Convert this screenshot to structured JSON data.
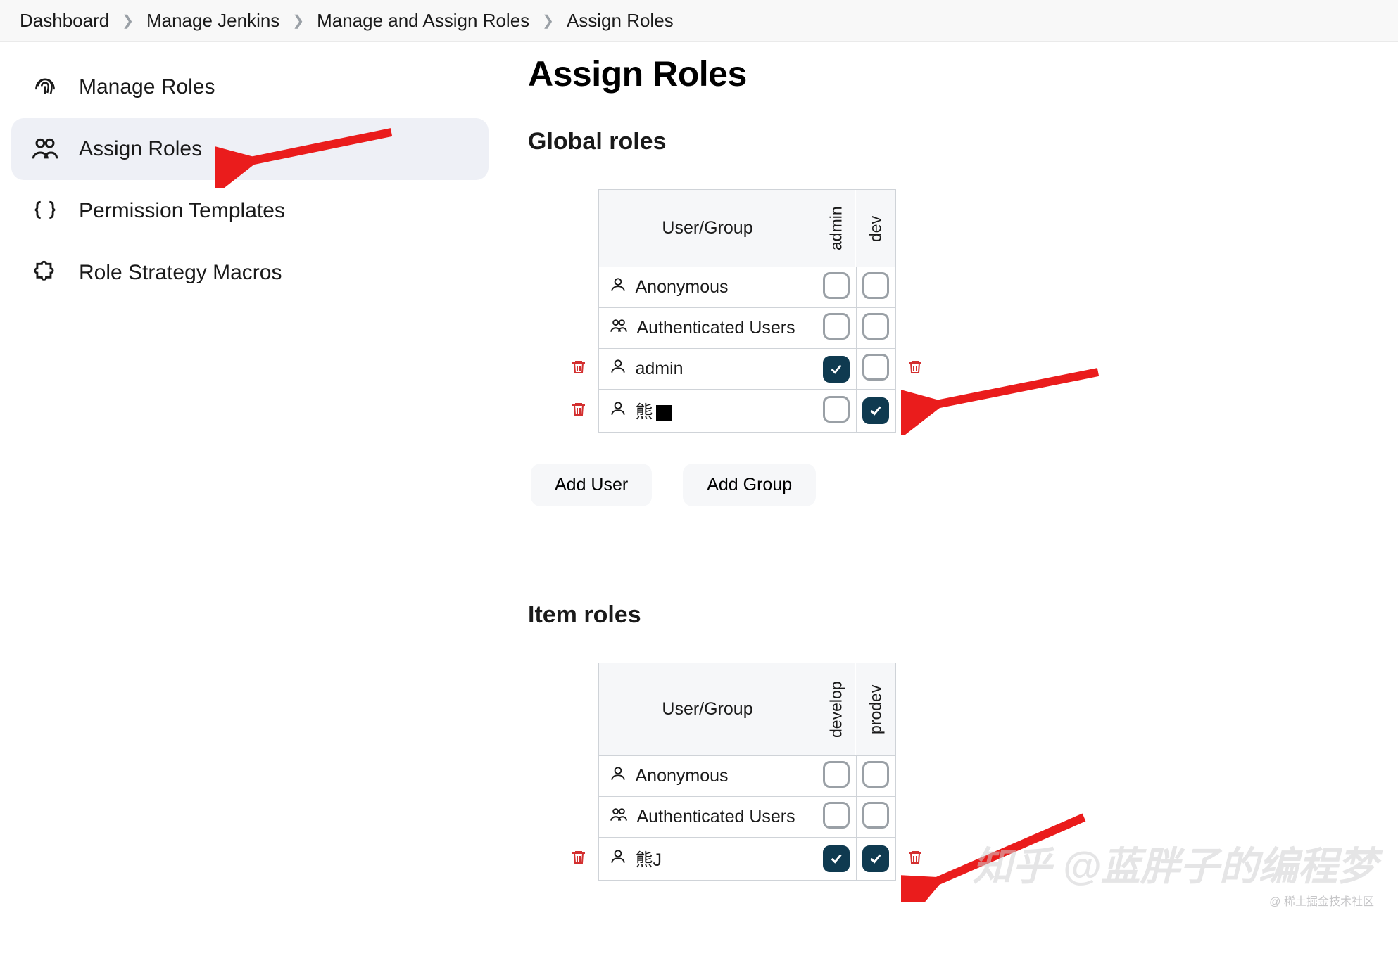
{
  "breadcrumb": [
    {
      "label": "Dashboard"
    },
    {
      "label": "Manage Jenkins"
    },
    {
      "label": "Manage and Assign Roles"
    },
    {
      "label": "Assign Roles"
    }
  ],
  "sidebar": {
    "items": [
      {
        "label": "Manage Roles"
      },
      {
        "label": "Assign Roles"
      },
      {
        "label": "Permission Templates"
      },
      {
        "label": "Role Strategy Macros"
      }
    ]
  },
  "page": {
    "title": "Assign Roles"
  },
  "global": {
    "section_title": "Global roles",
    "usergroup_header": "User/Group",
    "roles": [
      "admin",
      "dev"
    ],
    "rows": [
      {
        "name": "Anonymous",
        "icon": "user",
        "checks": [
          false,
          false
        ],
        "trash": false
      },
      {
        "name": "Authenticated Users",
        "icon": "group",
        "checks": [
          false,
          false
        ],
        "trash": false
      },
      {
        "name": "admin",
        "icon": "user",
        "checks": [
          true,
          false
        ],
        "trash": true
      },
      {
        "name": "熊",
        "icon": "user",
        "checks": [
          false,
          true
        ],
        "trash": true,
        "redacted": true
      }
    ],
    "add_user_label": "Add User",
    "add_group_label": "Add Group"
  },
  "item": {
    "section_title": "Item roles",
    "usergroup_header": "User/Group",
    "roles": [
      "develop",
      "prodev"
    ],
    "rows": [
      {
        "name": "Anonymous",
        "icon": "user",
        "checks": [
          false,
          false
        ],
        "trash": false
      },
      {
        "name": "Authenticated Users",
        "icon": "group",
        "checks": [
          false,
          false
        ],
        "trash": false
      },
      {
        "name": "熊J",
        "icon": "user",
        "checks": [
          true,
          true
        ],
        "trash": true
      }
    ]
  },
  "watermark": {
    "main": "知乎 @蓝胖子的编程梦",
    "sub": "@ 稀土掘金技术社区"
  }
}
